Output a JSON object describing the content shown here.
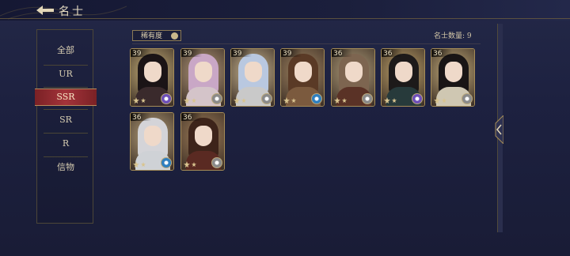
{
  "header": {
    "title": "名士"
  },
  "sidebar": {
    "items": [
      {
        "label": "全部",
        "active": false
      },
      {
        "label": "UR",
        "active": false
      },
      {
        "label": "SSR",
        "active": true
      },
      {
        "label": "SR",
        "active": false
      },
      {
        "label": "R",
        "active": false
      },
      {
        "label": "信物",
        "active": false
      }
    ]
  },
  "toolbar": {
    "filter_label": "稀有度",
    "count_label": "名士数量: 9"
  },
  "cards": [
    {
      "level": "39",
      "badge_color": "#6d4fb8",
      "hair": "#1b1416",
      "bg": "#c9b27b",
      "outfit": "#3a2a2c"
    },
    {
      "level": "39",
      "badge_color": "#8a8a8a",
      "hair": "#c9a7c6",
      "bg": "#b59b7d",
      "outfit": "#d4c4c9"
    },
    {
      "level": "39",
      "badge_color": "#8a8a8a",
      "hair": "#b9c8e0",
      "bg": "#ccb994",
      "outfit": "#c9c9c9"
    },
    {
      "level": "39",
      "badge_color": "#2f7fbf",
      "hair": "#5a3a26",
      "bg": "#a38663",
      "outfit": "#7b5a3e"
    },
    {
      "level": "36",
      "badge_color": "#8a8a8a",
      "hair": "#7d6550",
      "bg": "#b3a07c",
      "outfit": "#5a3226"
    },
    {
      "level": "36",
      "badge_color": "#6d4fb8",
      "hair": "#1d1a1a",
      "bg": "#c1a56c",
      "outfit": "#273a3b"
    },
    {
      "level": "36",
      "badge_color": "#8a8a8a",
      "hair": "#191515",
      "bg": "#c5ae7c",
      "outfit": "#cfc7b2"
    },
    {
      "level": "36",
      "badge_color": "#2f7fbf",
      "hair": "#d4d4d8",
      "bg": "#b8a27c",
      "outfit": "#cfd2d6"
    },
    {
      "level": "36",
      "badge_color": "#8a8a8a",
      "hair": "#3d241a",
      "bg": "#a17f5a",
      "outfit": "#5a2a22"
    }
  ]
}
